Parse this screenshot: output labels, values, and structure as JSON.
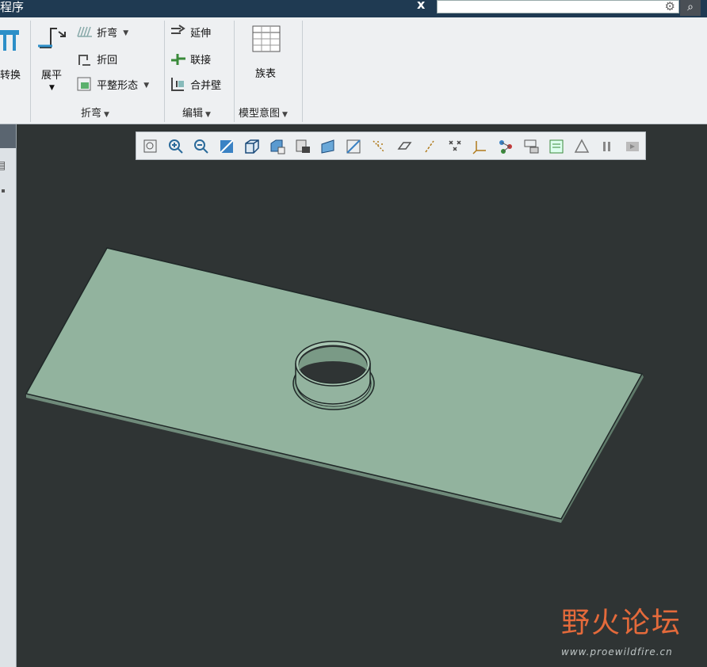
{
  "title_bar": {
    "title": "程序",
    "close_glyph": "x"
  },
  "search": {
    "placeholder": "",
    "gear_icon": "gear-icon",
    "search_icon": "search-icon"
  },
  "ribbon": {
    "convert_label": "转换",
    "unfold_label": "展平",
    "bend_label": "折弯",
    "bendback_label": "折回",
    "flat_state_label": "平整形态",
    "extend_label": "延伸",
    "join_label": "联接",
    "merge_wall_label": "合并壁",
    "family_table_label": "族表",
    "groups": {
      "bend": "折弯",
      "edit": "编辑",
      "model_intent": "模型意图"
    }
  },
  "view_toolbar": {
    "icons": [
      "refit-icon",
      "zoom-in-icon",
      "zoom-out-icon",
      "repaint-icon",
      "display-style-icon",
      "saved-views-icon",
      "view-manager-icon",
      "perspective-icon",
      "section-icon",
      "datum-display-icon",
      "plane-display-icon",
      "axis-display-icon",
      "point-display-icon",
      "csys-display-icon",
      "spin-center-icon",
      "annotation-display-icon",
      "note-display-icon",
      "appearance-icon",
      "pause-icon",
      "toggle-icon"
    ]
  },
  "watermark": {
    "brand": "野火论坛",
    "url": "www.proewildfire.cn"
  },
  "colors": {
    "viewport_bg": "#2f3434",
    "part_face": "#92b39e",
    "part_edge": "#1f2727",
    "ribbon_bg": "#eef0f2",
    "brand": "#e46a3b"
  }
}
